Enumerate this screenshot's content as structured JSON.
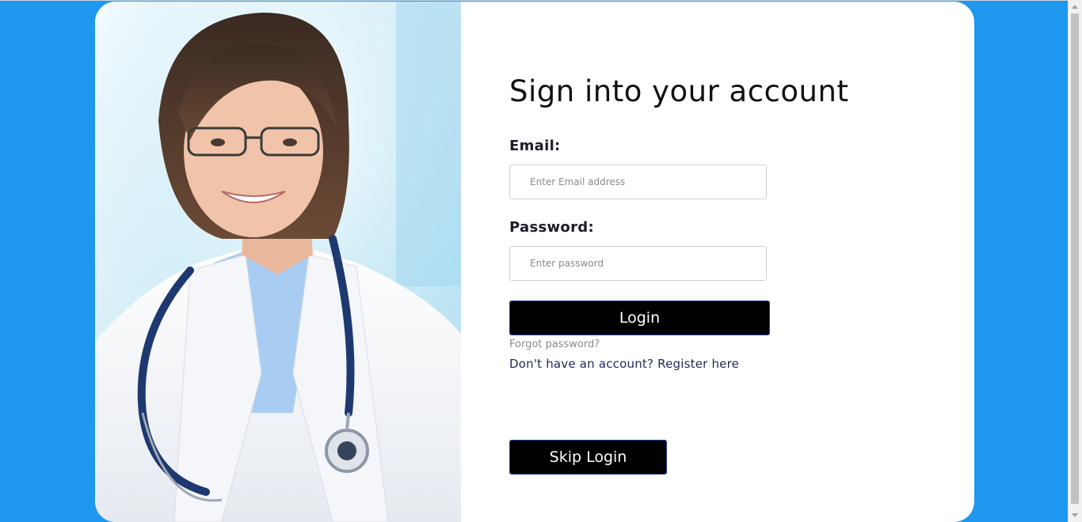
{
  "login": {
    "title": "Sign into your account",
    "email_label": "Email:",
    "email_placeholder": "Enter Email address",
    "email_value": "",
    "password_label": "Password:",
    "password_placeholder": "Enter password",
    "password_value": "",
    "login_button": "Login",
    "forgot_password": "Forgot password?",
    "register_prompt": "Don't have an account?",
    "register_link": "Register here",
    "skip_button": "Skip Login"
  },
  "image": {
    "subject": "doctor-photo"
  },
  "colors": {
    "background": "#1e98ee",
    "card": "#ffffff",
    "button": "#000000",
    "button_text": "#ffffff",
    "link": "#1f2a55",
    "muted_link": "#8a8a8a"
  }
}
